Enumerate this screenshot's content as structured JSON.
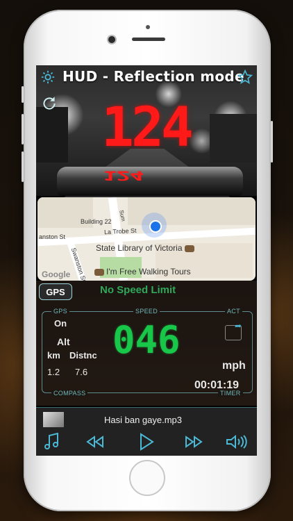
{
  "header": {
    "title": "HUD - Reflection mode",
    "speed_display": "124",
    "mirror_display": "124"
  },
  "map": {
    "labels": {
      "building": "Building 22",
      "street_left": "anston St",
      "street_top": "La Trobe St",
      "street_vertical": "Swanston St",
      "library": "State Library of Victoria",
      "poi": "I'm Free Walking Tours",
      "google": "Google",
      "corner": "Sum"
    }
  },
  "speed_panel": {
    "gps_button": "GPS",
    "speed_limit": "No Speed Limit",
    "labels": {
      "gps": "GPS",
      "speed": "SPEED",
      "act": "ACT",
      "compass": "COMPASS",
      "timer": "TIMER"
    },
    "gps_state": "On",
    "alt_label": "Alt",
    "km_label": "km",
    "distance_label": "Distnc",
    "km_value": "1.2",
    "distance_value": "7.6",
    "speed_value": "046",
    "unit": "mph",
    "timer_value": "00:01:19"
  },
  "player": {
    "track": "Hasi ban gaye.mp3"
  },
  "colors": {
    "hud_red": "#ff1a1a",
    "speed_green": "#18c64a",
    "accent_cyan": "#4bb9d6",
    "limit_green": "#2fa85a"
  }
}
